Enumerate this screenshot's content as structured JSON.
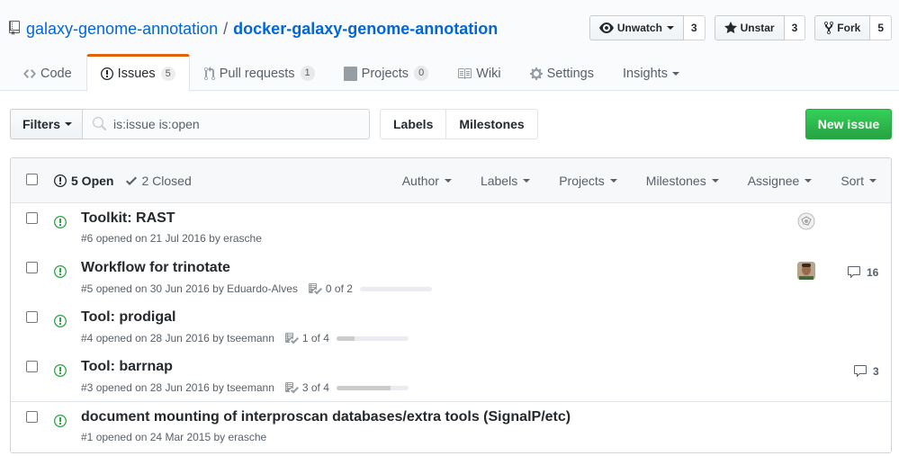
{
  "repo": {
    "owner": "galaxy-genome-annotation",
    "separator": "/",
    "name": "docker-galaxy-genome-annotation"
  },
  "actions": {
    "watch": {
      "label": "Unwatch",
      "count": "3"
    },
    "star": {
      "label": "Unstar",
      "count": "3"
    },
    "fork": {
      "label": "Fork",
      "count": "5"
    }
  },
  "nav": {
    "code": "Code",
    "issues": "Issues",
    "issues_count": "5",
    "pulls": "Pull requests",
    "pulls_count": "1",
    "projects": "Projects",
    "projects_count": "0",
    "wiki": "Wiki",
    "settings": "Settings",
    "insights": "Insights"
  },
  "subnav": {
    "filters": "Filters",
    "search_value": "is:issue is:open",
    "labels": "Labels",
    "milestones": "Milestones",
    "new_issue": "New issue"
  },
  "list_header": {
    "open": "5 Open",
    "closed": "2 Closed",
    "filters": [
      "Author",
      "Labels",
      "Projects",
      "Milestones",
      "Assignee",
      "Sort"
    ]
  },
  "issues": [
    {
      "title": "Toolkit: RAST",
      "number": "#6",
      "opened": "opened on 21 Jul 2016 by",
      "author": "erasche",
      "progress": null,
      "comments": null,
      "avatar": "identicon"
    },
    {
      "title": "Workflow for trinotate",
      "number": "#5",
      "opened": "opened on 30 Jun 2016 by",
      "author": "Eduardo-Alves",
      "progress": {
        "label": "0 of 2",
        "fraction": 0.0
      },
      "comments": "16",
      "avatar": "photo"
    },
    {
      "title": "Tool: prodigal",
      "number": "#4",
      "opened": "opened on 28 Jun 2016 by",
      "author": "tseemann",
      "progress": {
        "label": "1 of 4",
        "fraction": 0.25
      },
      "comments": null,
      "avatar": null
    },
    {
      "title": "Tool: barrnap",
      "number": "#3",
      "opened": "opened on 28 Jun 2016 by",
      "author": "tseemann",
      "progress": {
        "label": "3 of 4",
        "fraction": 0.75
      },
      "comments": "3",
      "avatar": null
    },
    {
      "title": "document mounting of interproscan databases/extra tools (SignalP/etc)",
      "number": "#1",
      "opened": "opened on 24 Mar 2015 by",
      "author": "erasche",
      "progress": null,
      "comments": null,
      "avatar": null
    }
  ],
  "colors": {
    "link": "#0366d6",
    "open_green": "#28a745",
    "nav_accent": "#e36209"
  }
}
